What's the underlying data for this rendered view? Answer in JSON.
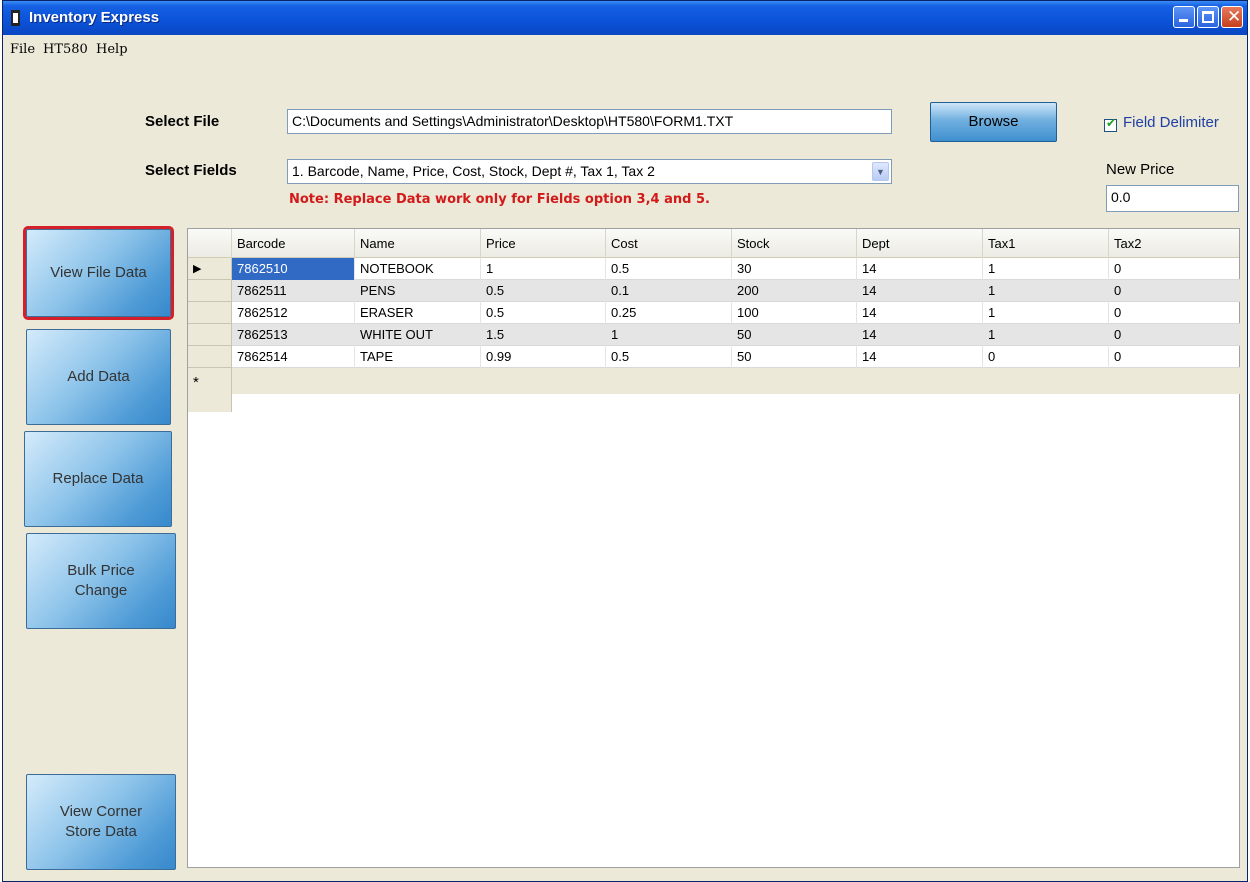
{
  "window": {
    "title": "Inventory Express"
  },
  "menu": [
    "File",
    "HT580",
    "Help"
  ],
  "form": {
    "select_file_label": "Select File",
    "file_path": "C:\\Documents and Settings\\Administrator\\Desktop\\HT580\\FORM1.TXT",
    "browse_label": "Browse",
    "field_delimiter_label": "Field Delimiter",
    "field_delimiter_checked": true,
    "select_fields_label": "Select Fields",
    "fields_selected": "1. Barcode, Name, Price, Cost, Stock, Dept #, Tax 1, Tax 2",
    "note": "Note: Replace Data work only for Fields option 3,4 and 5.",
    "new_price_label": "New Price",
    "new_price_value": "0.0"
  },
  "sidebar": {
    "buttons": [
      {
        "label": "View File Data",
        "selected": true
      },
      {
        "label": "Add Data",
        "selected": false
      },
      {
        "label": "Replace Data",
        "selected": false
      },
      {
        "label": "Bulk Price Change",
        "selected": false
      },
      {
        "label": "View Corner Store Data",
        "selected": false
      }
    ]
  },
  "grid": {
    "columns": [
      "Barcode",
      "Name",
      "Price",
      "Cost",
      "Stock",
      "Dept",
      "Tax1",
      "Tax2"
    ],
    "rows": [
      [
        "7862510",
        "NOTEBOOK",
        "1",
        "0.5",
        "30",
        "14",
        "1",
        "0"
      ],
      [
        "7862511",
        "PENS",
        "0.5",
        "0.1",
        "200",
        "14",
        "1",
        "0"
      ],
      [
        "7862512",
        "ERASER",
        "0.5",
        "0.25",
        "100",
        "14",
        "1",
        "0"
      ],
      [
        "7862513",
        "WHITE OUT",
        "1.5",
        "1",
        "50",
        "14",
        "1",
        "0"
      ],
      [
        "7862514",
        "TAPE",
        "0.99",
        "0.5",
        "50",
        "14",
        "0",
        "0"
      ]
    ],
    "current_row_marker": "▶",
    "new_row_marker": "*",
    "selected_cell": "7862510"
  }
}
